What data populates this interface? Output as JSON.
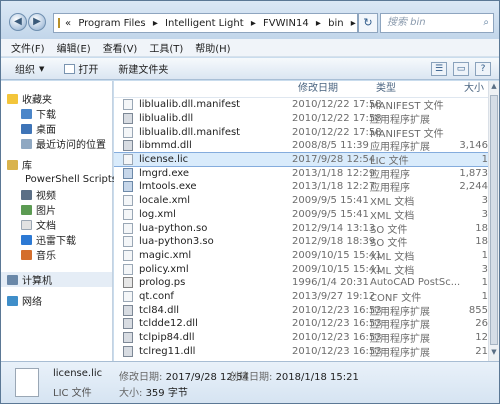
{
  "address": {
    "back_icon": "back-arrow-icon",
    "forward_icon": "forward-arrow-icon",
    "prefix": "«",
    "crumbs": [
      "Program Files",
      "▸",
      "Intelligent Light",
      "▸",
      "FVWIN14",
      "▸",
      "bin",
      "▸"
    ],
    "search_placeholder": "搜索 bin"
  },
  "menu": [
    "文件(F)",
    "编辑(E)",
    "查看(V)",
    "工具(T)",
    "帮助(H)"
  ],
  "toolbar": {
    "organize": "组织",
    "open": "打开",
    "new_folder": "新建文件夹"
  },
  "nav": {
    "favorites": "收藏夹",
    "downloads": "下载",
    "desktop": "桌面",
    "recent": "最近访问的位置",
    "libraries": "库",
    "powershell": "PowerShell Scripts",
    "videos": "视频",
    "pictures": "图片",
    "documents": "文档",
    "thunder": "迅雷下载",
    "music": "音乐",
    "computer": "计算机",
    "network": "网络"
  },
  "columns": {
    "name": "",
    "date": "修改日期",
    "type": "类型",
    "size": "大小"
  },
  "files": [
    {
      "name": "liblualib.dll.manifest",
      "date": "2010/12/22 17:58",
      "type": "MANIFEST 文件",
      "size": "",
      "icon": "doc"
    },
    {
      "name": "liblualib.dll",
      "date": "2010/12/22 17:58",
      "type": "应用程序扩展",
      "size": "",
      "icon": "cog"
    },
    {
      "name": "liblualib.dll.manifest",
      "date": "2010/12/22 17:58",
      "type": "MANIFEST 文件",
      "size": "",
      "icon": "doc"
    },
    {
      "name": "libmmd.dll",
      "date": "2008/8/5 11:39",
      "type": "应用程序扩展",
      "size": "3,146",
      "icon": "cog"
    },
    {
      "name": "license.lic",
      "date": "2017/9/28 12:54",
      "type": "LIC 文件",
      "size": "1",
      "icon": "doc",
      "selected": true
    },
    {
      "name": "lmgrd.exe",
      "date": "2013/1/18 12:29",
      "type": "应用程序",
      "size": "1,873",
      "icon": "app"
    },
    {
      "name": "lmtools.exe",
      "date": "2013/1/18 12:27",
      "type": "应用程序",
      "size": "2,244",
      "icon": "app"
    },
    {
      "name": "locale.xml",
      "date": "2009/9/5 15:41",
      "type": "XML 文档",
      "size": "3",
      "icon": "doc"
    },
    {
      "name": "log.xml",
      "date": "2009/9/5 15:41",
      "type": "XML 文档",
      "size": "3",
      "icon": "doc"
    },
    {
      "name": "lua-python.so",
      "date": "2012/9/14 13:13",
      "type": "SO 文件",
      "size": "18",
      "icon": "doc"
    },
    {
      "name": "lua-python3.so",
      "date": "2012/9/18 18:39",
      "type": "SO 文件",
      "size": "18",
      "icon": "doc"
    },
    {
      "name": "magic.xml",
      "date": "2009/10/15 15:41",
      "type": "XML 文档",
      "size": "1",
      "icon": "doc"
    },
    {
      "name": "policy.xml",
      "date": "2009/10/15 15:41",
      "type": "XML 文档",
      "size": "3",
      "icon": "doc"
    },
    {
      "name": "prolog.ps",
      "date": "1996/1/4 20:31",
      "type": "AutoCAD PostSc...",
      "size": "1",
      "icon": "ps"
    },
    {
      "name": "qt.conf",
      "date": "2013/9/27 19:12",
      "type": "CONF 文件",
      "size": "1",
      "icon": "doc"
    },
    {
      "name": "tcl84.dll",
      "date": "2010/12/23 16:53",
      "type": "应用程序扩展",
      "size": "855",
      "icon": "cog"
    },
    {
      "name": "tcldde12.dll",
      "date": "2010/12/23 16:53",
      "type": "应用程序扩展",
      "size": "26",
      "icon": "cog"
    },
    {
      "name": "tclpip84.dll",
      "date": "2010/12/23 16:53",
      "type": "应用程序扩展",
      "size": "12",
      "icon": "cog"
    },
    {
      "name": "tclreg11.dll",
      "date": "2010/12/23 16:53",
      "type": "应用程序扩展",
      "size": "21",
      "icon": "cog"
    }
  ],
  "details": {
    "name": "license.lic",
    "type": "LIC 文件",
    "modified_label": "修改日期:",
    "modified": "2017/9/28 12:54",
    "size_label": "大小:",
    "size": "359 字节",
    "created_label": "创建日期:",
    "created": "2018/1/18 15:21"
  }
}
